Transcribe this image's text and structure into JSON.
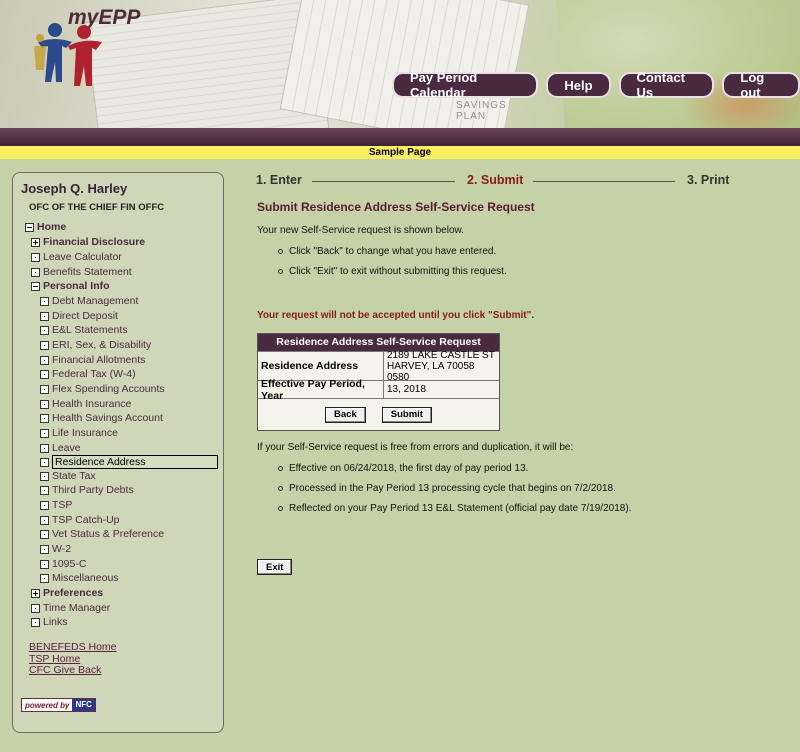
{
  "header": {
    "logo_text": "myEPP",
    "savings_line1": "SAVINGS",
    "savings_line2": "PLAN",
    "nav": [
      "Pay Period Calendar",
      "Help",
      "Contact Us",
      "Log out"
    ]
  },
  "banner": {
    "text": "Sample Page"
  },
  "sidebar": {
    "user_name": "Joseph Q. Harley",
    "office": "OFC OF THE CHIEF FIN OFFC",
    "items": [
      {
        "label": "Home",
        "icon": "minus"
      },
      {
        "label": "Financial Disclosure",
        "icon": "plus"
      },
      {
        "label": "Leave Calculator",
        "icon": "dot"
      },
      {
        "label": "Benefits Statement",
        "icon": "dot"
      },
      {
        "label": "Personal Info",
        "icon": "minus"
      },
      {
        "label": "Debt Management",
        "icon": "dot"
      },
      {
        "label": "Direct Deposit",
        "icon": "dot"
      },
      {
        "label": "E&L Statements",
        "icon": "dot"
      },
      {
        "label": "ERI, Sex, & Disability",
        "icon": "dot"
      },
      {
        "label": "Financial Allotments",
        "icon": "dot"
      },
      {
        "label": "Federal Tax (W-4)",
        "icon": "dot"
      },
      {
        "label": "Flex Spending Accounts",
        "icon": "dot"
      },
      {
        "label": "Health Insurance",
        "icon": "dot"
      },
      {
        "label": "Health Savings Account",
        "icon": "dot"
      },
      {
        "label": "Life Insurance",
        "icon": "dot"
      },
      {
        "label": "Leave",
        "icon": "dot"
      },
      {
        "label": "Residence Address",
        "icon": "dot"
      },
      {
        "label": "State Tax",
        "icon": "dot"
      },
      {
        "label": "Third Party Debts",
        "icon": "dot"
      },
      {
        "label": "TSP",
        "icon": "dot"
      },
      {
        "label": "TSP Catch-Up",
        "icon": "dot"
      },
      {
        "label": "Vet Status & Preference",
        "icon": "dot"
      },
      {
        "label": "W-2",
        "icon": "dot"
      },
      {
        "label": "1095-C",
        "icon": "dot"
      },
      {
        "label": "Miscellaneous",
        "icon": "dot"
      },
      {
        "label": "Preferences",
        "icon": "plus"
      },
      {
        "label": "Time Manager",
        "icon": "dot"
      },
      {
        "label": "Links",
        "icon": "dot"
      }
    ],
    "links": [
      "BENEFEDS Home",
      "TSP Home",
      "CFC Give Back"
    ],
    "powered_by": "powered by",
    "powered_brand": "NFC"
  },
  "steps": [
    "1. Enter",
    "2. Submit",
    "3. Print"
  ],
  "main": {
    "title": "Submit Residence Address Self-Service Request",
    "intro": "Your new Self-Service request is shown below.",
    "instructions": [
      "Click \"Back\" to change what you have entered.",
      "Click \"Exit\" to exit without submitting this request."
    ],
    "warning": "Your request will not be accepted until you click \"Submit\".",
    "table": {
      "heading": "Residence Address Self-Service Request",
      "rows": [
        {
          "label": "Residence Address",
          "value_line1": "2189 LAKE CASTLE ST",
          "value_line2": "HARVEY, LA 70058 0580"
        },
        {
          "label": "Effective Pay Period, Year",
          "value_line1": "13, 2018"
        }
      ],
      "back_label": "Back",
      "submit_label": "Submit"
    },
    "outcome_intro": "If your Self-Service request is free from errors and duplication, it will be:",
    "outcomes": [
      "Effective on 06/24/2018, the first day of pay period 13.",
      "Processed in the Pay Period 13 processing cycle that begins on 7/2/2018.",
      "Reflected on your Pay Period 13 E&L Statement (official pay date 7/19/2018)."
    ],
    "exit_label": "Exit"
  },
  "colors": {
    "brand_plum": "#4a2a40",
    "background_sage": "#c5d2a8",
    "banner_yellow": "#f8ef62",
    "step_active": "#8b1a1a",
    "warning_red": "#8b1a1a"
  }
}
